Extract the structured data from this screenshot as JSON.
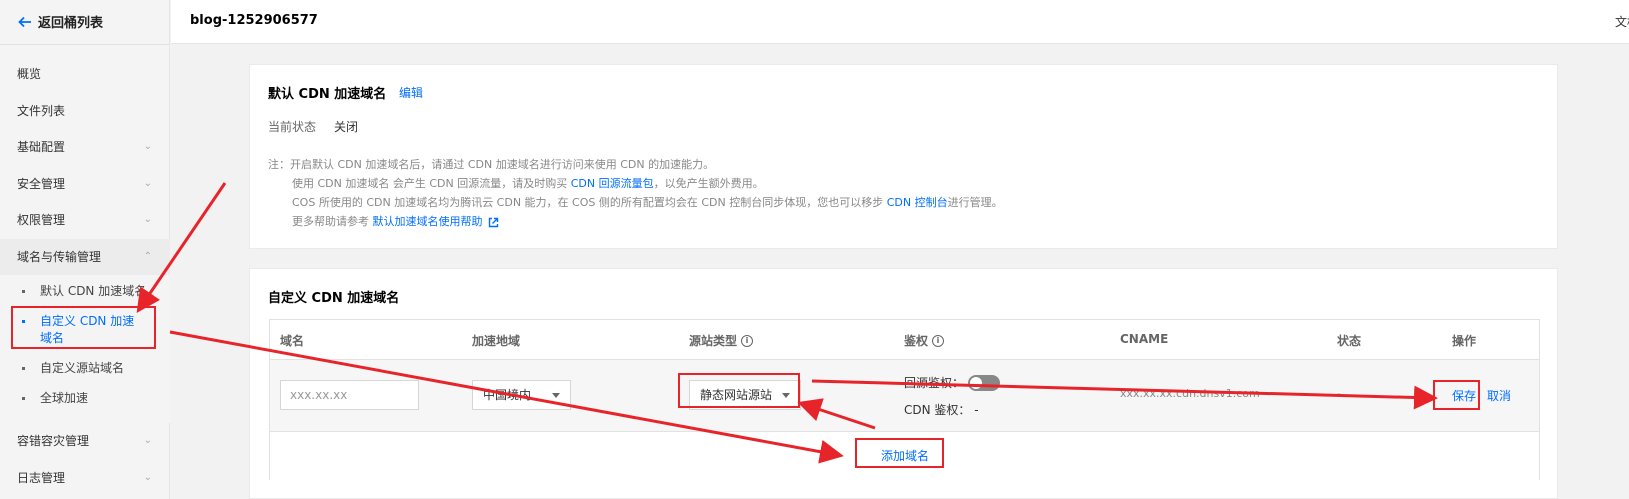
{
  "sidebar": {
    "back_label": "返回桶列表",
    "items": [
      {
        "label": "概览",
        "chevron": false
      },
      {
        "label": "文件列表",
        "chevron": false
      },
      {
        "label": "基础配置",
        "chevron": true
      },
      {
        "label": "安全管理",
        "chevron": true
      },
      {
        "label": "权限管理",
        "chevron": true
      },
      {
        "label": "域名与传输管理",
        "chevron": true
      }
    ],
    "sub_items": [
      {
        "label": "默认 CDN 加速域名"
      },
      {
        "label": "自定义 CDN 加速域名"
      },
      {
        "label": "自定义源站域名"
      },
      {
        "label": "全球加速"
      }
    ],
    "bottom_items": [
      {
        "label": "容错容灾管理"
      },
      {
        "label": "日志管理"
      }
    ]
  },
  "header": {
    "bucket_name": "blog-1252906577",
    "right_link": "文档"
  },
  "default_cdn": {
    "title": "默认 CDN 加速域名",
    "edit_label": "编辑",
    "status_label": "当前状态",
    "status_value": "关闭",
    "note_line1": "注：开启默认 CDN 加速域名后，请通过 CDN 加速域名进行访问来使用 CDN 的加速能力。",
    "note_line2_prefix": "使用 CDN 加速域名 会产生 CDN 回源流量，请及时购买 ",
    "note_line2_link": "CDN 回源流量包",
    "note_line2_suffix": "，以免产生额外费用。",
    "note_line3_prefix": "COS 所使用的 CDN 加速域名均为腾讯云 CDN 能力，在 COS 侧的所有配置均会在 CDN 控制台同步体现，您也可以移步 ",
    "note_line3_link": "CDN 控制台",
    "note_line3_suffix": "进行管理。",
    "note_line4_prefix": "更多帮助请参考 ",
    "note_line4_link": "默认加速域名使用帮助"
  },
  "custom_cdn": {
    "title": "自定义 CDN 加速域名",
    "columns": {
      "domain": "域名",
      "region": "加速地域",
      "origin_type": "源站类型",
      "auth": "鉴权",
      "cname": "CNAME",
      "status": "状态",
      "actions": "操作"
    },
    "row": {
      "domain_placeholder": "xxx.xx.xx",
      "region_value": "中国境内",
      "origin_type_value": "静态网站源站",
      "origin_auth_label": "回源鉴权：",
      "origin_auth_enabled": false,
      "cdn_auth_label": "CDN 鉴权：",
      "cdn_auth_value": "-",
      "cname_value": "xxx.xx.xx.cdn.dnsv1.com",
      "status_value": "-",
      "save_label": "保存",
      "cancel_label": "取消"
    },
    "add_label": "添加域名"
  },
  "colors": {
    "link": "#006eff",
    "annotation": "#e8242b"
  }
}
